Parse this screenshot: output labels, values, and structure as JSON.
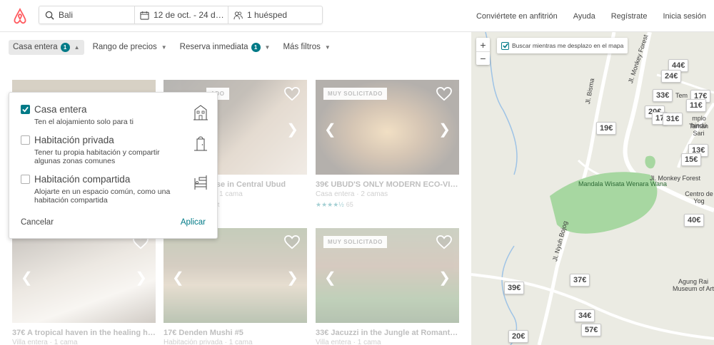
{
  "header": {
    "search_location": "Bali",
    "search_dates": "12 de oct. - 24 de oct.",
    "search_guests": "1 huésped",
    "nav": [
      "Conviértete en anfitrión",
      "Ayuda",
      "Regístrate",
      "Inicia sesión"
    ]
  },
  "filters": {
    "home_type": {
      "label": "Casa entera",
      "badge": "1"
    },
    "price": {
      "label": "Rango de precios"
    },
    "instant": {
      "label": "Reserva inmediata",
      "badge": "1"
    },
    "more": {
      "label": "Más filtros"
    }
  },
  "dropdown": {
    "options": [
      {
        "label": "Casa entera",
        "desc": "Ten el alojamiento solo para ti",
        "checked": true
      },
      {
        "label": "Habitación privada",
        "desc": "Tener tu propia habitación y compartir algunas zonas comunes",
        "checked": false
      },
      {
        "label": "Habitación compartida",
        "desc": "Alojarte en un espacio común, como una habitación compartida",
        "checked": false
      }
    ],
    "cancel": "Cancelar",
    "apply": "Aplicar"
  },
  "listings": [
    {
      "title": "",
      "sub": "",
      "stars": "★★★★★",
      "reviews": "",
      "tag": ""
    },
    {
      "title": "adise in Central Ubud",
      "sub": "da · 1 cama",
      "stars": "★★★★★",
      "reviews": "uperhost",
      "tag": "ADO"
    },
    {
      "title": "39€ UBUD'S ONLY MODERN ECO-VIL...",
      "sub": "Casa entera · 2 camas",
      "stars": "★★★★½",
      "reviews": "65",
      "tag": "MUY SOLICITADO"
    },
    {
      "title": "37€ A tropical haven in the healing he...",
      "sub": "Villa entera · 1 cama",
      "tag": ""
    },
    {
      "title": "17€ Denden Mushi #5",
      "sub": "Habitación privada · 1 cama",
      "tag": ""
    },
    {
      "title": "33€ Jacuzzi in the Jungle at Romantic ...",
      "sub": "Villa entera · 1 cama",
      "tag": "MUY SOLICITADO"
    }
  ],
  "map": {
    "search_toggle": "Buscar mientras me desplazo en el mapa",
    "zoom_in": "+",
    "zoom_out": "−",
    "pins": [
      "44€",
      "24€",
      "33€",
      "17€",
      "11€",
      "20€",
      "17",
      "31€",
      "19€",
      "13€",
      "15€",
      "40€",
      "37€",
      "39€",
      "34€",
      "57€",
      "20€"
    ],
    "labels": {
      "park": "Mandala Wisata Wenara Wana",
      "road1": "Jl. Monkey Forest",
      "road2": "Jl. Monkey Forest",
      "road3": "Jl. Bisma",
      "road4": "Jl. Nyuh Bojog",
      "centro": "Centro de Yog",
      "museum": "Agung Rai Museum of Art",
      "temple": "Tem",
      "temple2": "mplo hindú",
      "taman": "Taman Sari"
    }
  },
  "colors": {
    "brand": "#ff5a5f",
    "accent": "#007a87"
  }
}
